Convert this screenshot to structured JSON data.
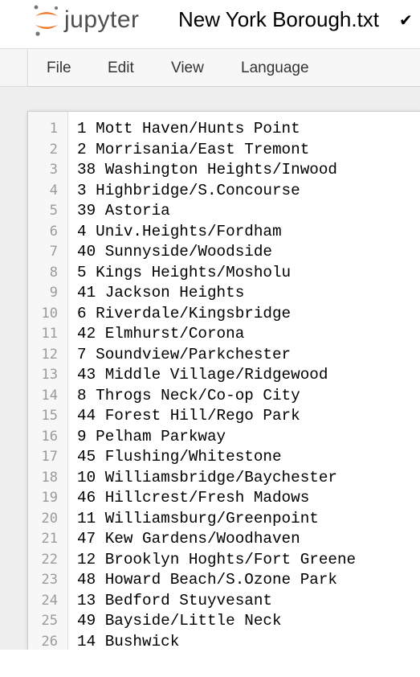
{
  "header": {
    "logo_text": "jupyter",
    "document_title": "New York Borough.txt",
    "save_status_icon": "checkmark-icon"
  },
  "menu": {
    "items": [
      "File",
      "Edit",
      "View",
      "Language"
    ]
  },
  "editor": {
    "lines": [
      {
        "number": "1",
        "text": "1 Mott Haven/Hunts Point"
      },
      {
        "number": "2",
        "text": "2 Morrisania/East Tremont"
      },
      {
        "number": "3",
        "text": "38 Washington Heights/Inwood"
      },
      {
        "number": "4",
        "text": "3 Highbridge/S.Concourse"
      },
      {
        "number": "5",
        "text": "39 Astoria"
      },
      {
        "number": "6",
        "text": "4 Univ.Heights/Fordham"
      },
      {
        "number": "7",
        "text": "40 Sunnyside/Woodside"
      },
      {
        "number": "8",
        "text": "5 Kings Heights/Mosholu"
      },
      {
        "number": "9",
        "text": "41 Jackson Heights"
      },
      {
        "number": "10",
        "text": "6 Riverdale/Kingsbridge"
      },
      {
        "number": "11",
        "text": "42 Elmhurst/Corona"
      },
      {
        "number": "12",
        "text": "7 Soundview/Parkchester"
      },
      {
        "number": "13",
        "text": "43 Middle Village/Ridgewood"
      },
      {
        "number": "14",
        "text": "8 Throgs Neck/Co-op City"
      },
      {
        "number": "15",
        "text": "44 Forest Hill/Rego Park"
      },
      {
        "number": "16",
        "text": "9 Pelham Parkway"
      },
      {
        "number": "17",
        "text": "45 Flushing/Whitestone"
      },
      {
        "number": "18",
        "text": "10 Williamsbridge/Baychester"
      },
      {
        "number": "19",
        "text": "46 Hillcrest/Fresh Madows"
      },
      {
        "number": "20",
        "text": "11 Williamsburg/Greenpoint"
      },
      {
        "number": "21",
        "text": "47 Kew Gardens/Woodhaven"
      },
      {
        "number": "22",
        "text": "12 Brooklyn Hoghts/Fort Greene"
      },
      {
        "number": "23",
        "text": "48 Howard Beach/S.Ozone Park"
      },
      {
        "number": "24",
        "text": "13 Bedford Stuyvesant"
      },
      {
        "number": "25",
        "text": "49 Bayside/Little Neck"
      },
      {
        "number": "26",
        "text": "14 Bushwick"
      }
    ]
  },
  "colors": {
    "logo_orange": "#f37726",
    "logo_gray": "#767677",
    "menubar_bg": "#f5f5f5",
    "work_area_bg": "#eeeeee",
    "gutter_text": "#9a9a9a"
  }
}
